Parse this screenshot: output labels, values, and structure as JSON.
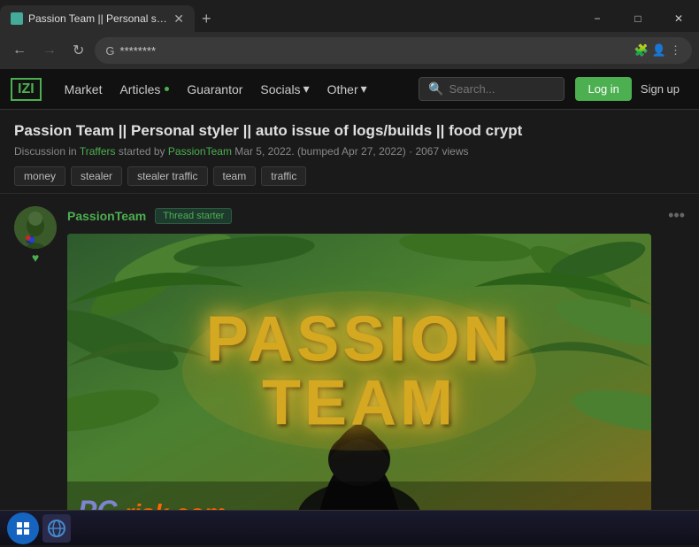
{
  "browser": {
    "tab_title": "Passion Team || Personal styler ||...",
    "address": "********",
    "nav_back_disabled": false,
    "nav_forward_disabled": true
  },
  "navbar": {
    "logo": "IZI",
    "items": [
      {
        "label": "Market",
        "has_dot": false
      },
      {
        "label": "Articles",
        "has_dot": true
      },
      {
        "label": "Guarantor",
        "has_dot": false
      },
      {
        "label": "Socials",
        "has_dot": false,
        "has_arrow": true
      },
      {
        "label": "Other",
        "has_dot": false,
        "has_arrow": true
      }
    ],
    "search_placeholder": "Search...",
    "login_label": "Log in",
    "signup_label": "Sign up"
  },
  "thread": {
    "title": "Passion Team || Personal styler || auto issue of logs/builds || food crypt",
    "meta_discussion": "Discussion in",
    "meta_forum": "Traffers",
    "meta_started": "started by",
    "meta_author": "PassionTeam",
    "meta_date": "Mar 5, 2022.",
    "meta_bumped": "(bumped Apr 27, 2022)",
    "meta_views": "2067 views",
    "tags": [
      "money",
      "stealer",
      "stealer traffic",
      "team",
      "traffic"
    ]
  },
  "post": {
    "username": "PassionTeam",
    "badge": "Thread starter",
    "more_icon": "•••",
    "image_alt": "Passion Team banner with tropical leaves"
  },
  "image_text": {
    "line1": "PASSION",
    "line2": "TEAM",
    "watermark_logo": "ΡС",
    "watermark_domain": "risk.com"
  },
  "window_controls": {
    "minimize": "−",
    "maximize": "□",
    "close": "✕"
  }
}
